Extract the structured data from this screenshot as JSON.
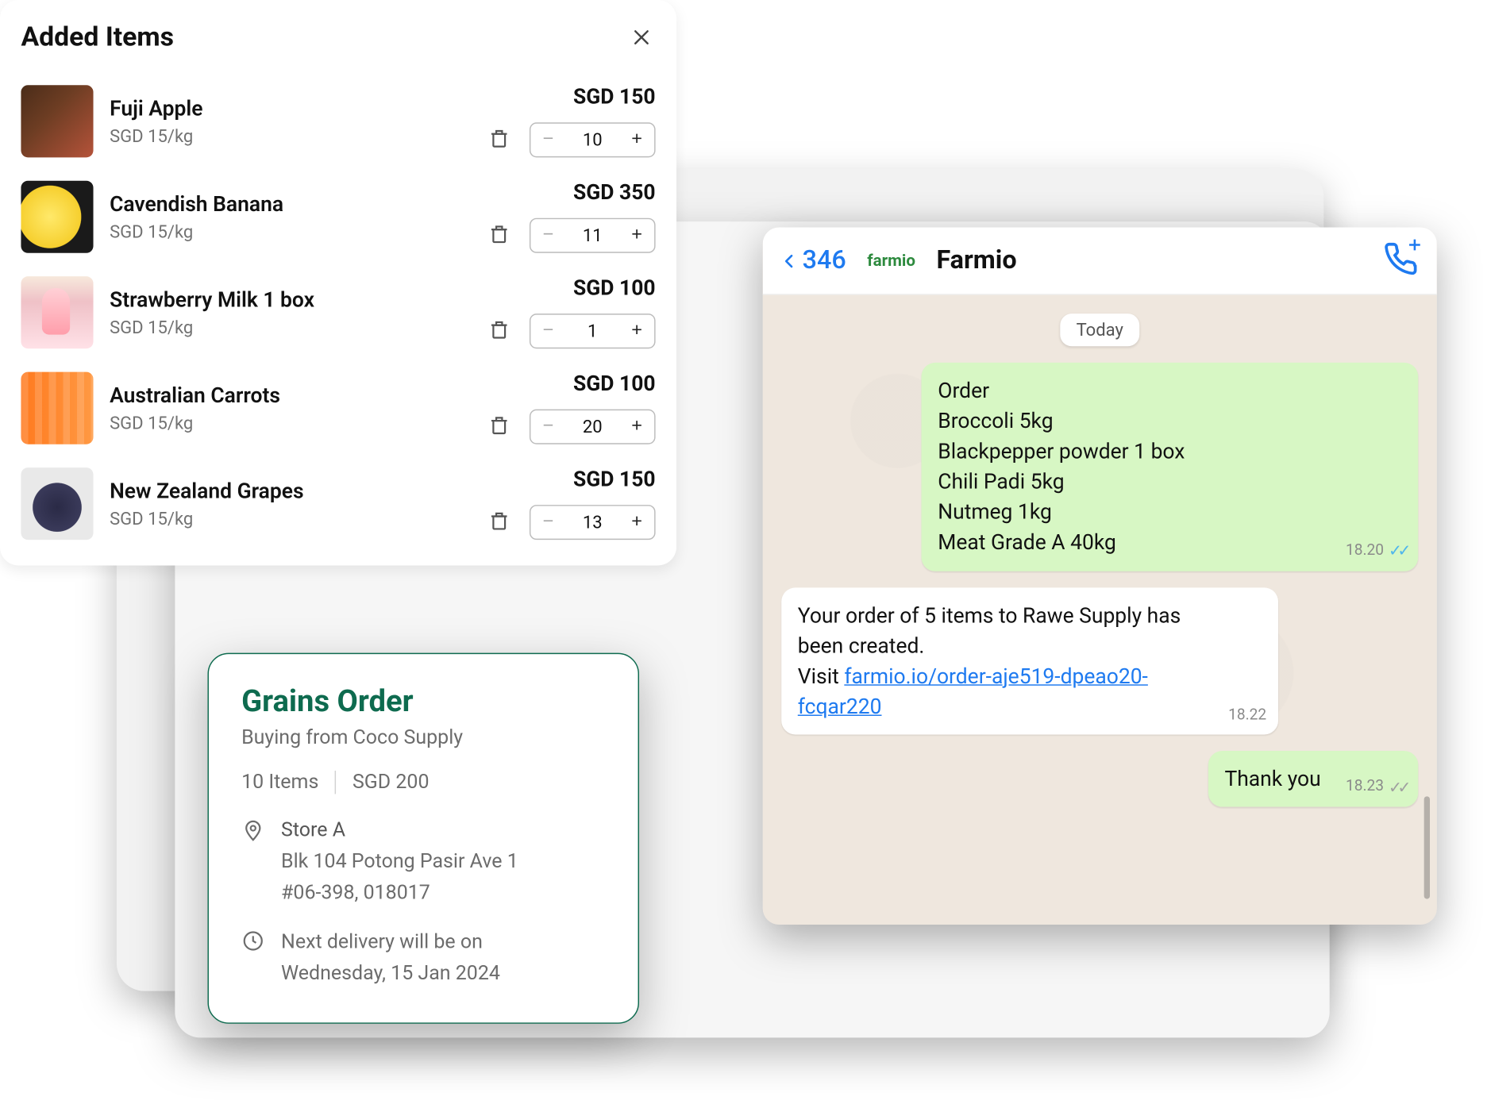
{
  "addedItems": {
    "title": "Added Items",
    "items": [
      {
        "name": "Fuji Apple",
        "rate": "SGD 15/kg",
        "total": "SGD 150",
        "qty": "10"
      },
      {
        "name": "Cavendish Banana",
        "rate": "SGD 15/kg",
        "total": "SGD 350",
        "qty": "11"
      },
      {
        "name": "Strawberry Milk 1 box",
        "rate": "SGD 15/kg",
        "total": "SGD 100",
        "qty": "1"
      },
      {
        "name": "Australian Carrots",
        "rate": "SGD 15/kg",
        "total": "SGD 100",
        "qty": "20"
      },
      {
        "name": "New Zealand Grapes",
        "rate": "SGD 15/kg",
        "total": "SGD 150",
        "qty": "13"
      }
    ]
  },
  "grains": {
    "title": "Grains Order",
    "subtitle": "Buying from Coco Supply",
    "itemsLabel": "10 Items",
    "amount": "SGD 200",
    "storeName": "Store A",
    "addr1": "Blk 104 Potong Pasir Ave 1",
    "addr2": "#06-398, 018017",
    "deliveryLine1": "Next delivery will be on",
    "deliveryLine2": "Wednesday, 15 Jan 2024"
  },
  "chat": {
    "backCount": "346",
    "logo": "farmio",
    "contact": "Farmio",
    "dateLabel": "Today",
    "msg1": {
      "l0": "Order",
      "l1": "Broccoli 5kg",
      "l2": "Blackpepper powder 1 box",
      "l3": "Chili Padi 5kg",
      "l4": "Nutmeg 1kg",
      "l5": "Meat Grade A 40kg",
      "time": "18.20"
    },
    "msg2": {
      "textA": "Your order of 5 items to Rawe Supply has been created.",
      "textB": "Visit ",
      "link": "farmio.io/order-aje519-dpeao20-fcqar220",
      "time": "18.22"
    },
    "msg3": {
      "text": "Thank you",
      "time": "18.23"
    }
  }
}
